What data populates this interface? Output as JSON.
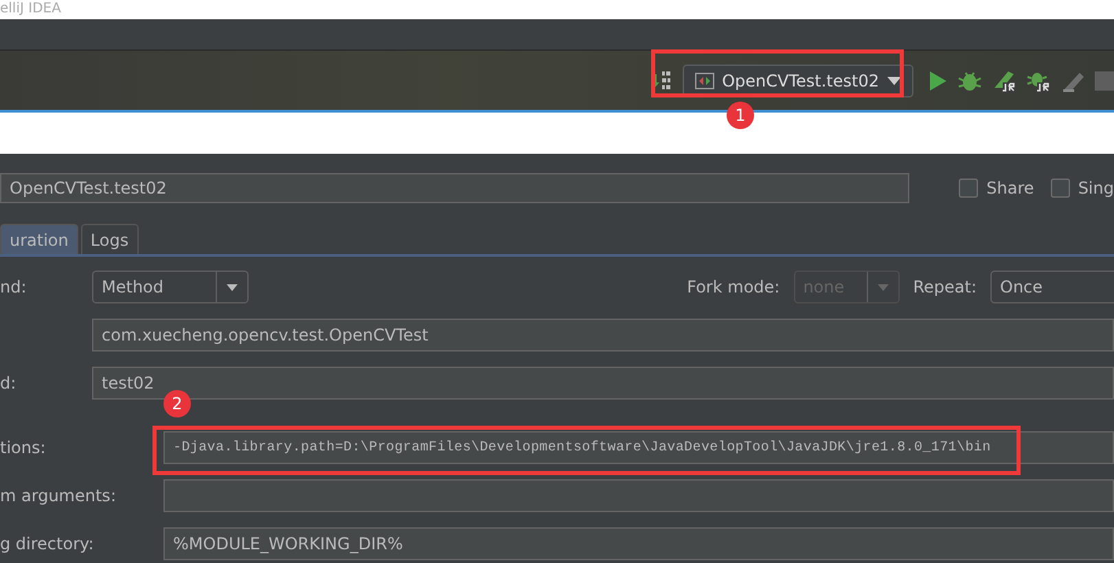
{
  "window": {
    "title": "elliJ IDEA"
  },
  "toolbar": {
    "run_config": "OpenCVTest.test02"
  },
  "dialog": {
    "name": "OpenCVTest.test02",
    "checkboxes": [
      {
        "label": "Share",
        "checked": false
      },
      {
        "label": "Sing",
        "checked": false
      }
    ],
    "tabs": [
      {
        "label": "uration",
        "selected": true
      },
      {
        "label": "Logs",
        "selected": false
      }
    ],
    "rows": [
      {
        "kind": "combo",
        "label": "nd:",
        "value": "Method",
        "fork_label": "Fork mode:",
        "fork_value": "none",
        "repeat_label": "Repeat:",
        "repeat_value": "Once"
      },
      {
        "kind": "field",
        "value": "com.xuecheng.opencv.test.OpenCVTest"
      },
      {
        "kind": "field",
        "label": "d:",
        "value": "test02"
      },
      {
        "kind": "mono",
        "label": "tions:",
        "value": "-Djava.library.path=D:\\ProgramFiles\\Developmentsoftware\\JavaDevelopTool\\JavaJDK\\jre1.8.0_171\\bin"
      },
      {
        "kind": "field",
        "label": "m arguments:"
      },
      {
        "kind": "field",
        "label": "g directory:",
        "value": "%MODULE_WORKING_DIR%"
      }
    ]
  },
  "annotations": [
    {
      "label": "1"
    },
    {
      "label": "2"
    }
  ]
}
